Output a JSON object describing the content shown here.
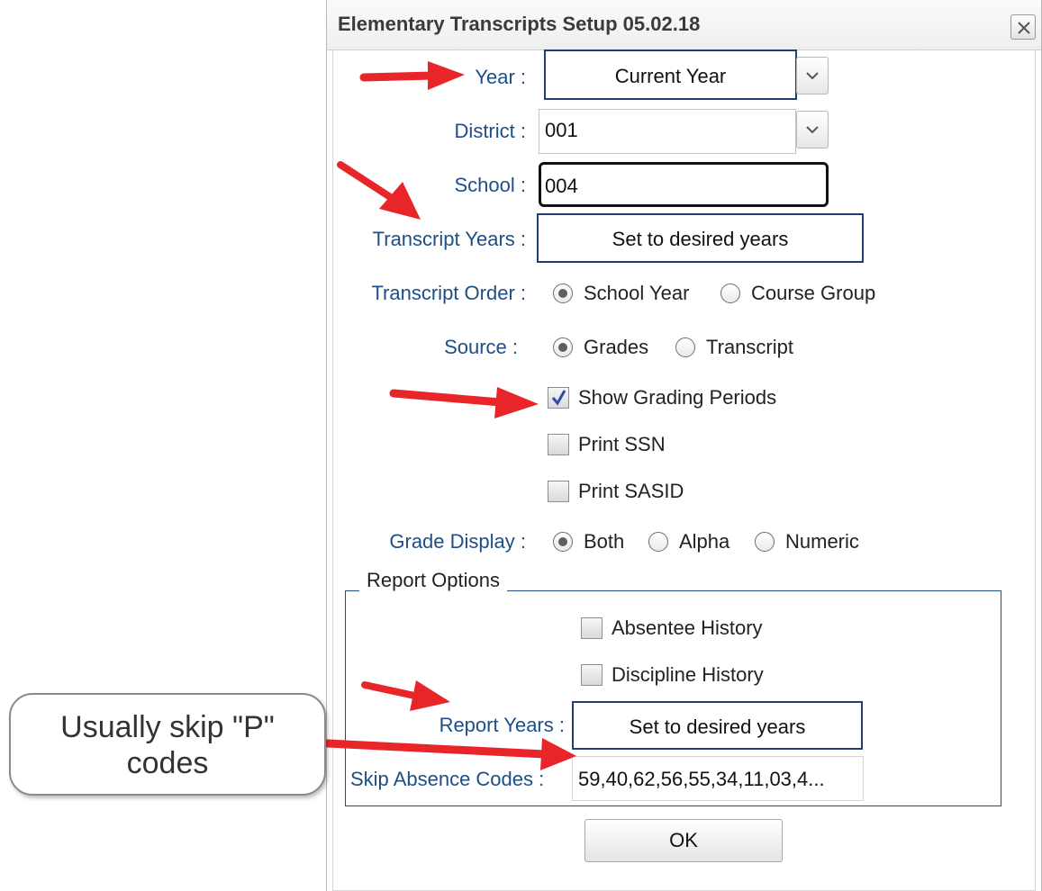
{
  "window": {
    "title": "Elementary Transcripts Setup 05.02.18"
  },
  "year": {
    "label": "Year :",
    "value": "Current Year"
  },
  "district": {
    "label": "District :",
    "value": "001"
  },
  "school": {
    "label": "School :",
    "value": "004"
  },
  "transcript_years": {
    "label": "Transcript Years :",
    "value": "Set to desired years"
  },
  "transcript_order": {
    "label": "Transcript Order :",
    "options": [
      {
        "label": "School Year",
        "selected": true
      },
      {
        "label": "Course Group",
        "selected": false
      }
    ]
  },
  "source": {
    "label": "Source :",
    "options": [
      {
        "label": "Grades",
        "selected": true
      },
      {
        "label": "Transcript",
        "selected": false
      }
    ]
  },
  "checkboxes": [
    {
      "label": "Show Grading Periods",
      "checked": true
    },
    {
      "label": "Print SSN",
      "checked": false
    },
    {
      "label": "Print SASID",
      "checked": false
    }
  ],
  "grade_display": {
    "label": "Grade Display :",
    "options": [
      {
        "label": "Both",
        "selected": true
      },
      {
        "label": "Alpha",
        "selected": false
      },
      {
        "label": "Numeric",
        "selected": false
      }
    ]
  },
  "report_options": {
    "legend": "Report Options",
    "checkboxes": [
      {
        "label": "Absentee History",
        "checked": false
      },
      {
        "label": "Discipline History",
        "checked": false
      }
    ],
    "report_years": {
      "label": "Report Years :",
      "value": "Set to desired years"
    },
    "skip_absence_codes": {
      "label": "Skip Absence Codes :",
      "value": "59,40,62,56,55,34,11,03,4..."
    }
  },
  "ok_label": "OK",
  "callout": {
    "line1": "Usually skip \"P\"",
    "line2": "codes"
  },
  "colors": {
    "arrow": "#e8262a",
    "label": "#1f4e86",
    "highlight_border": "#1f3f73"
  }
}
